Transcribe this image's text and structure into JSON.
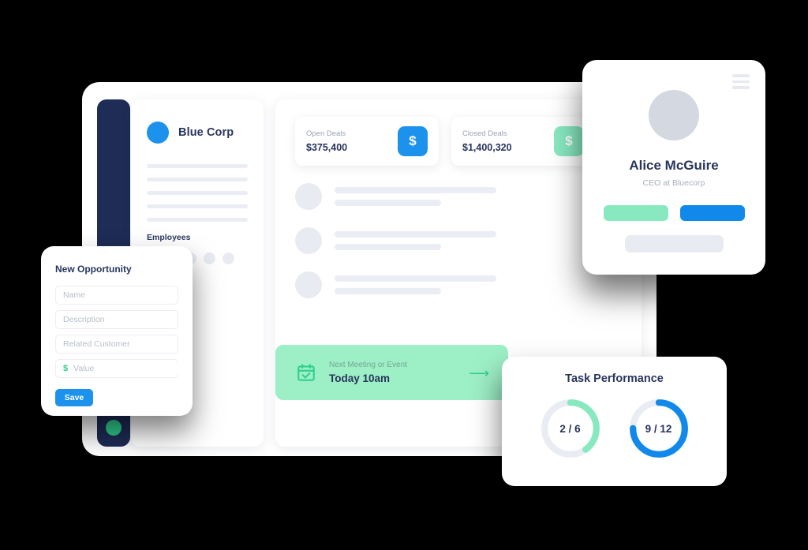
{
  "theme": {
    "background": "#000000",
    "navy": "#1e2c56",
    "blue": "#1d92ed",
    "green": "#88e9c0",
    "green_solid": "#2fcf8f",
    "banner_green": "#9defc6",
    "skeleton": "#eaedf3",
    "text_dark": "#28355c",
    "text_muted": "#9aa3b5"
  },
  "dashboard": {
    "sidebar": {
      "status_dot_name": "online-status-dot"
    },
    "company": {
      "name": "Blue Corp",
      "avatar_icon": "company-avatar-circle",
      "skeleton_lines": 5,
      "employees_label": "Employees",
      "employee_dots": 5
    },
    "stats": [
      {
        "label": "Open Deals",
        "value": "$375,400",
        "icon": "dollar-icon",
        "icon_color": "#1d92ed"
      },
      {
        "label": "Closed Deals",
        "value": "$1,400,320",
        "icon": "dollar-icon",
        "icon_color": "#88e9c0"
      }
    ],
    "list_rows": [
      {
        "avatar_icon": "avatar-placeholder"
      },
      {
        "avatar_icon": "avatar-placeholder"
      },
      {
        "avatar_icon": "avatar-placeholder"
      }
    ],
    "meeting": {
      "icon": "calendar-check-icon",
      "label": "Next Meeting or Event",
      "value": "Today 10am",
      "arrow_icon": "arrow-right-icon"
    }
  },
  "profile_card": {
    "menu_icon": "hamburger-menu-icon",
    "avatar_icon": "user-avatar-placeholder",
    "name": "Alice McGuire",
    "role": "CEO at Bluecorp",
    "actions": [
      {
        "name": "profile-action-green",
        "color": "#88e9c0"
      },
      {
        "name": "profile-action-blue",
        "color": "#1189ea"
      }
    ],
    "field_placeholder_name": "profile-detail-field"
  },
  "opportunity_form": {
    "title": "New Opportunity",
    "fields": [
      {
        "name": "name-field",
        "placeholder": "Name",
        "value": ""
      },
      {
        "name": "description-field",
        "placeholder": "Description",
        "value": ""
      },
      {
        "name": "related-customer-field",
        "placeholder": "Related Customer",
        "value": ""
      }
    ],
    "value_field": {
      "currency": "$",
      "placeholder": "Value",
      "value": ""
    },
    "save_label": "Save"
  },
  "task_performance": {
    "title": "Task Performance"
  },
  "chart_data": [
    {
      "type": "pie",
      "title": "Task Performance",
      "subtype": "donut-gauge",
      "label": "2 / 6",
      "completed": 2,
      "total": 6,
      "percent": 40,
      "color": "#88e9c0",
      "track_color": "#e9ecf2",
      "legend": "green-gauge"
    },
    {
      "type": "pie",
      "title": "Task Performance",
      "subtype": "donut-gauge",
      "label": "9 / 12",
      "completed": 9,
      "total": 12,
      "percent": 75,
      "color": "#1189ea",
      "track_color": "#e9ecf2",
      "legend": "blue-gauge"
    }
  ]
}
